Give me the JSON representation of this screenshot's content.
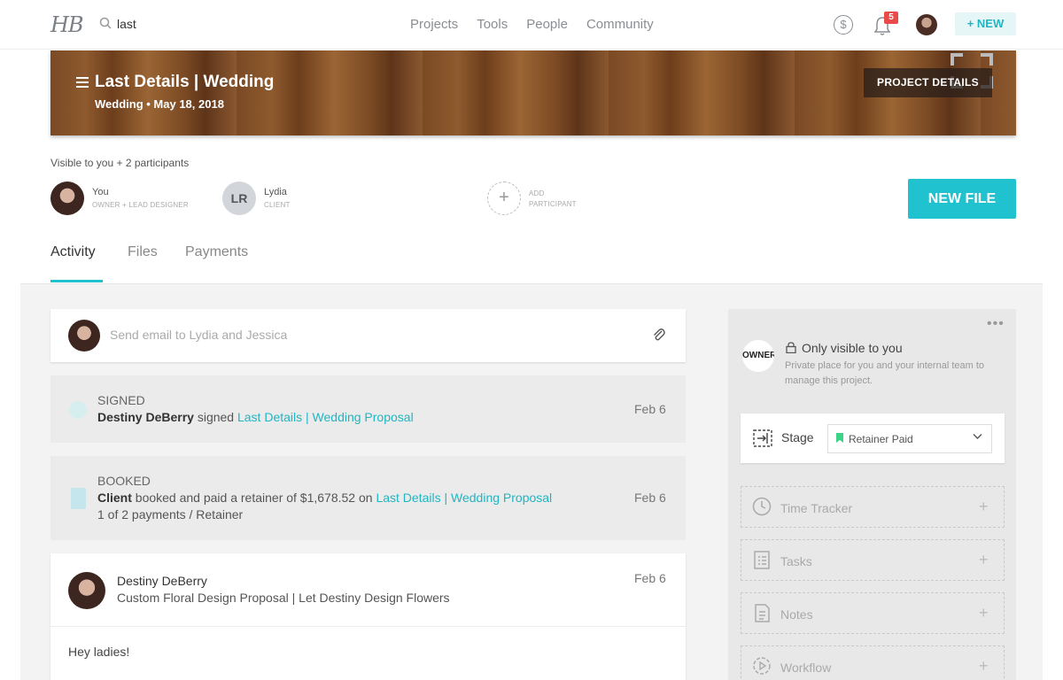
{
  "nav": {
    "logo": "HB",
    "search_value": "last",
    "links": [
      "Projects",
      "Tools",
      "People",
      "Community"
    ],
    "currency_symbol": "$",
    "notification_count": "5",
    "new_label": "+ NEW"
  },
  "banner": {
    "title": "Last Details | Wedding",
    "subtitle": "Wedding • May 18, 2018",
    "details_button": "PROJECT DETAILS"
  },
  "participants": {
    "visibility_text": "Visible to you + 2 participants",
    "people": [
      {
        "name": "You",
        "role": "OWNER + LEAD DESIGNER"
      },
      {
        "initials": "LR",
        "name": "Lydia",
        "role": "CLIENT"
      },
      {
        "name": "ADD",
        "role": "PARTICIPANT"
      }
    ],
    "new_file_label": "NEW FILE"
  },
  "tabs": [
    {
      "label": "Activity",
      "active": true
    },
    {
      "label": "Files",
      "active": false
    },
    {
      "label": "Payments",
      "active": false
    }
  ],
  "composer": {
    "placeholder": "Send email to Lydia and Jessica"
  },
  "activities": [
    {
      "type": "SIGNED",
      "actor": "Destiny DeBerry",
      "verb": " signed ",
      "link": "Last Details | Wedding Proposal",
      "date": "Feb 6"
    },
    {
      "type": "BOOKED",
      "actor": "Client",
      "verb": " booked and paid a retainer of $1,678.52 on ",
      "link": "Last Details | Wedding Proposal",
      "detail": "1 of 2 payments / Retainer",
      "date": "Feb 6"
    }
  ],
  "message": {
    "sender": "Destiny DeBerry",
    "subject": "Custom Floral Design Proposal | Let Destiny Design Flowers",
    "date": "Feb 6",
    "body": "Hey ladies!"
  },
  "sidebar": {
    "menu_dots": "•••",
    "owner_badge": "OWNER",
    "only_visible": "Only visible to you",
    "private_note": "Private place for you and your internal team to manage this project.",
    "stage_label": "Stage",
    "stage_value": "Retainer Paid",
    "tools": [
      {
        "label": "Time Tracker",
        "icon": "clock-icon"
      },
      {
        "label": "Tasks",
        "icon": "checklist-icon"
      },
      {
        "label": "Notes",
        "icon": "notes-icon"
      },
      {
        "label": "Workflow",
        "icon": "workflow-icon"
      }
    ],
    "add_symbol": "+"
  },
  "colors": {
    "accent": "#21c2cf",
    "link": "#21b5c1",
    "badge": "#e94b4b",
    "panel_bg": "#e8e8e8"
  }
}
